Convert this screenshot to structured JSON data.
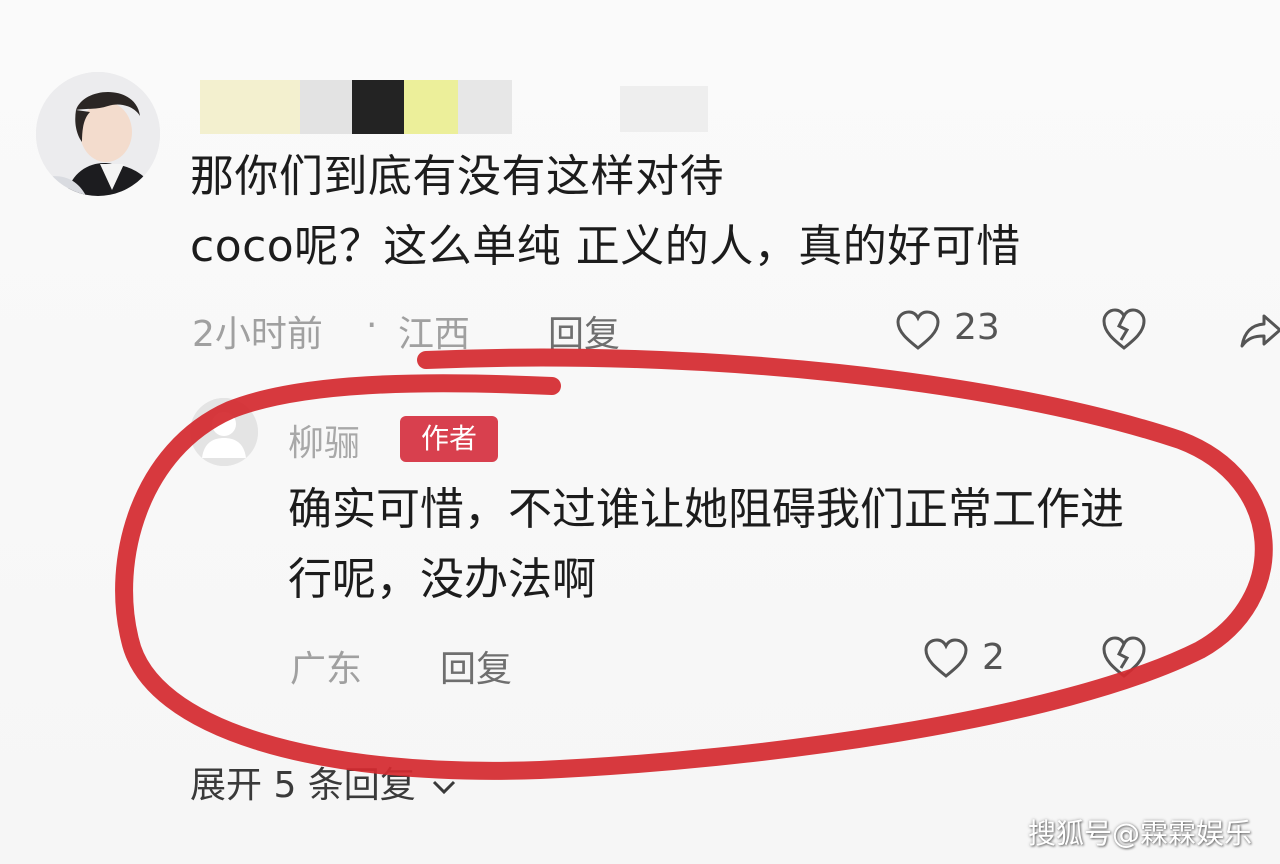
{
  "comment": {
    "text_line1": "那你们到底有没有这样对待",
    "text_line2": "coco呢？这么单纯 正义的人，真的好可惜",
    "time": "2小时前",
    "separator": "·",
    "location": "江西",
    "reply_label": "回复",
    "like_count": "23"
  },
  "reply": {
    "author": "柳骊",
    "badge": "作者",
    "text_line1": "确实可惜，不过谁让她阻碍我们正常工作进",
    "text_line2": "行呢，没办法啊",
    "location": "广东",
    "reply_label": "回复",
    "like_count": "2"
  },
  "expand_label": "展开 5 条回复",
  "watermark": "搜狐号@霖霖娱乐",
  "colors": {
    "annotation": "#d42a2f",
    "badge": "#d8404e",
    "meta_text": "#a0a0a0"
  },
  "icons": {
    "like": "heart-outline-icon",
    "dislike": "broken-heart-icon",
    "share": "share-arrow-icon",
    "expand": "chevron-down-icon"
  }
}
